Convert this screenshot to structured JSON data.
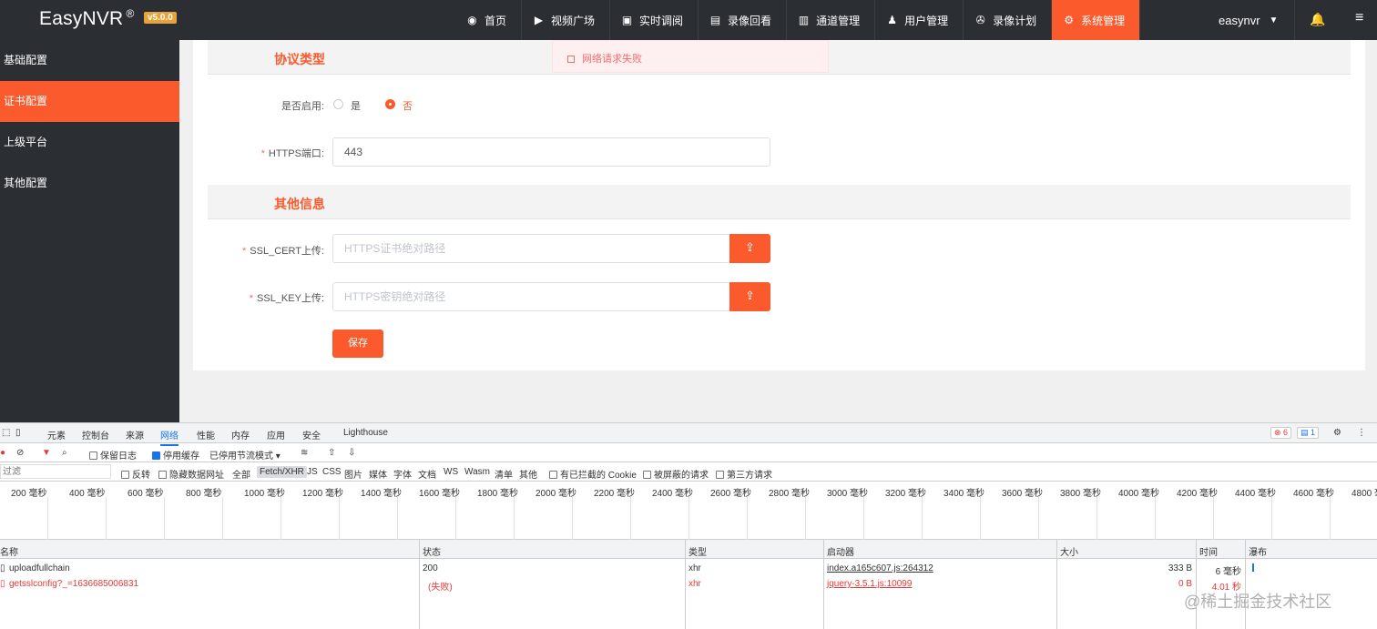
{
  "header": {
    "brand": "EasyNVR",
    "brand_mark": "®",
    "version": "v5.0.0",
    "nav": [
      {
        "label": "首页",
        "icon": "dashboard-icon",
        "active": false
      },
      {
        "label": "视频广场",
        "icon": "play-circle-icon",
        "active": false
      },
      {
        "label": "实时调阅",
        "icon": "video-icon",
        "active": false
      },
      {
        "label": "录像回看",
        "icon": "film-icon",
        "active": false
      },
      {
        "label": "通道管理",
        "icon": "columns-icon",
        "active": false
      },
      {
        "label": "用户管理",
        "icon": "user-cog-icon",
        "active": false
      },
      {
        "label": "录像计划",
        "icon": "reel-icon",
        "active": false
      },
      {
        "label": "系统管理",
        "icon": "gear-icon",
        "active": true
      }
    ],
    "user": "easynvr"
  },
  "sidebar": {
    "items": [
      {
        "label": "基础配置",
        "active": false
      },
      {
        "label": "证书配置",
        "active": true
      },
      {
        "label": "上级平台",
        "active": false
      },
      {
        "label": "其他配置",
        "active": false
      }
    ]
  },
  "toast": {
    "message": "网络请求失败"
  },
  "form": {
    "section1": "协议类型",
    "enable_label": "是否启用:",
    "enable_yes": "是",
    "enable_no": "否",
    "enable_value": "否",
    "https_port_label": "HTTPS端口:",
    "https_port_value": "443",
    "section2": "其他信息",
    "ssl_cert_label": "SSL_CERT上传:",
    "ssl_cert_placeholder": "HTTPS证书绝对路径",
    "ssl_key_label": "SSL_KEY上传:",
    "ssl_key_placeholder": "HTTPS密钥绝对路径",
    "save_label": "保存"
  },
  "devtools": {
    "tabs": [
      "元素",
      "控制台",
      "来源",
      "网络",
      "性能",
      "内存",
      "应用",
      "安全",
      "Lighthouse"
    ],
    "active_tab": "网络",
    "errors": "6",
    "messages": "1",
    "toolbar": {
      "preserve_log": "保留日志",
      "disable_cache": "停用缓存",
      "throttling": "已停用节流模式"
    },
    "filter": {
      "placeholder": "过滤",
      "invert": "反转",
      "hide_data_urls": "隐藏数据网址",
      "types": [
        "全部",
        "Fetch/XHR",
        "JS",
        "CSS",
        "图片",
        "媒体",
        "字体",
        "文档",
        "WS",
        "Wasm",
        "清单",
        "其他"
      ],
      "active_type": "Fetch/XHR",
      "blocked_cookies": "有已拦截的 Cookie",
      "blocked_requests": "被屏蔽的请求",
      "third_party": "第三方请求"
    },
    "timeline_ticks": [
      "200 毫秒",
      "400 毫秒",
      "600 毫秒",
      "800 毫秒",
      "1000 毫秒",
      "1200 毫秒",
      "1400 毫秒",
      "1600 毫秒",
      "1800 毫秒",
      "2000 毫秒",
      "2200 毫秒",
      "2400 毫秒",
      "2600 毫秒",
      "2800 毫秒",
      "3000 毫秒",
      "3200 毫秒",
      "3400 毫秒",
      "3600 毫秒",
      "3800 毫秒",
      "4000 毫秒",
      "4200 毫秒",
      "4400 毫秒",
      "4600 毫秒",
      "4800 毫秒"
    ],
    "columns": [
      "名称",
      "状态",
      "类型",
      "启动器",
      "大小",
      "时间",
      "瀑布"
    ],
    "rows": [
      {
        "name": "uploadfullchain",
        "status": "200",
        "type": "xhr",
        "initiator": "index.a165c607.js:264312",
        "size": "333 B",
        "time": "6 毫秒",
        "error": false
      },
      {
        "name": "getsslconfig?_=1636685006831",
        "status": "(失败)",
        "type": "xhr",
        "initiator": "jquery-3.5.1.js:10099",
        "size": "0 B",
        "time": "4.01 秒",
        "error": true
      }
    ]
  },
  "watermark": "@稀土掘金技术社区"
}
